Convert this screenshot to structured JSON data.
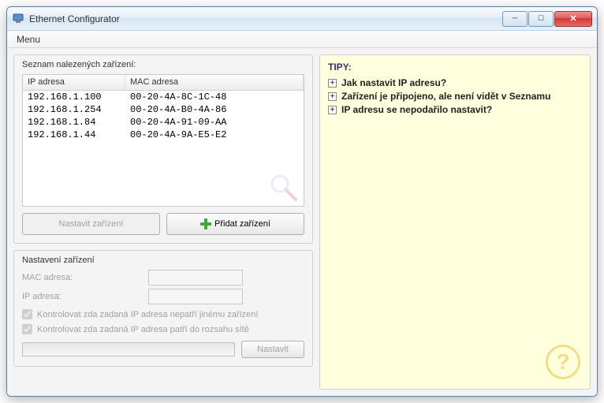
{
  "window": {
    "title": "Ethernet Configurator"
  },
  "menu": {
    "item1": "Menu"
  },
  "deviceList": {
    "title": "Seznam nalezených zařízení:",
    "colIp": "IP adresa",
    "colMac": "MAC adresa",
    "rows": [
      {
        "ip": "192.168.1.100",
        "mac": "00-20-4A-8C-1C-48"
      },
      {
        "ip": "192.168.1.254",
        "mac": "00-20-4A-B0-4A-86"
      },
      {
        "ip": "192.168.1.84",
        "mac": "00-20-4A-91-09-AA"
      },
      {
        "ip": "192.168.1.44",
        "mac": "00-20-4A-9A-E5-E2"
      }
    ]
  },
  "buttons": {
    "set_device": "Nastavit zařízení",
    "add_device": "Přidat zařízení",
    "apply": "Nastavit"
  },
  "settings": {
    "title": "Nastavení zařízení",
    "mac_label": "MAC adresa:",
    "ip_label": "IP adresa:",
    "check1": "Kontrolovat zda zadaná IP adresa nepatří jinému zařízení",
    "check2": "Kontrolovat zda zadaná IP adresa patří do rozsahu sítě"
  },
  "tips": {
    "title": "TIPY:",
    "items": [
      "Jak nastavit IP adresu?",
      "Zařízení je připojeno, ale není vidět v Seznamu",
      "IP adresu se nepodařilo nastavit?"
    ]
  },
  "help_symbol": "?"
}
